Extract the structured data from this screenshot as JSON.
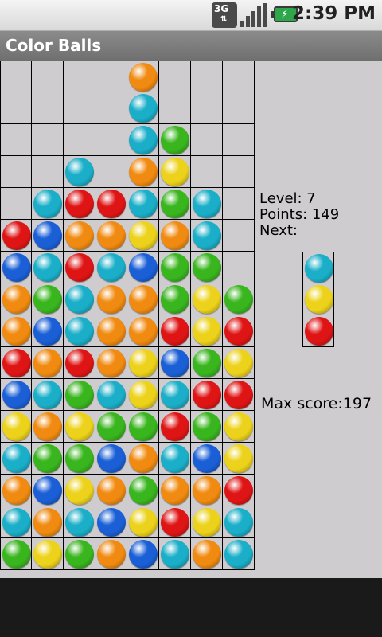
{
  "status_bar": {
    "network_label": "3G",
    "network_icon": "network-3g-icon",
    "signal_icon": "signal-strength-icon",
    "battery_icon": "battery-charging-icon",
    "time": "2:39 PM"
  },
  "app": {
    "title": "Color Balls"
  },
  "palette": {
    "O": "#f08a10",
    "C": "#1aaec8",
    "G": "#39b51e",
    "Y": "#ecd21a",
    "R": "#df1515",
    "B": "#1a5fd6"
  },
  "board": {
    "columns": 8,
    "rows": 16,
    "grid": [
      "....O...",
      "....C...",
      "....CG..",
      "..C.OY..",
      ".CRRCGC.",
      "RBOOYOC.",
      "BCRCBGG.",
      "OGCOOGYG",
      "OBCOORYR",
      "ROROYBGY",
      "BCGCYCRR",
      "YOYGGRGY",
      "CGGBOCBY",
      "OBYOGOOR",
      "COCBYRYC",
      "GYGOBCOC"
    ]
  },
  "info": {
    "level_text": "Level: 7",
    "points_text": "Points: 149",
    "next_label": "Next:",
    "next_balls": [
      "C",
      "Y",
      "R"
    ],
    "max_score_text": "Max score:197"
  }
}
